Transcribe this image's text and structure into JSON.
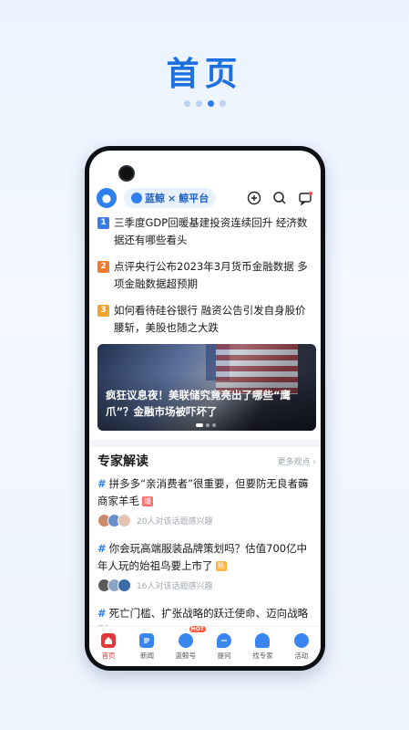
{
  "hero": {
    "title": "首页",
    "pager_count": 4,
    "pager_active": 2
  },
  "app": {
    "platform_name": "蓝鲸",
    "platform_sep": "×",
    "platform_suffix": "鲸平台",
    "icons": [
      "plus-circle-icon",
      "search-icon",
      "message-icon"
    ]
  },
  "news": [
    {
      "rank": "1",
      "text": "三季度GDP回暖基建投资连续回升 经济数据还有哪些看头"
    },
    {
      "rank": "2",
      "text": "点评央行公布2023年3月货币金融数据 多项金融数据超预期"
    },
    {
      "rank": "3",
      "text": "如何看待硅谷银行 融资公告引发自身股价腰斩，美股也随之大跌"
    }
  ],
  "banner": {
    "caption": "疯狂议息夜！美联储究竟亮出了哪些“鹰爪”？金融市场被吓坏了"
  },
  "experts": {
    "title": "专家解读",
    "more": "更多观点 ›",
    "topics": [
      {
        "text": "拼多多“亲消费者”很重要，但要防无良者薅商家羊毛",
        "tag": "爆",
        "meta": "20人对该话题感兴趣",
        "avatar_colors": [
          "#c98a6a",
          "#6a8fc9",
          "#e5c3b3"
        ]
      },
      {
        "text": "你会玩高端服装品牌策划吗？估值700亿中年人玩的始祖鸟要上市了",
        "tag": "热",
        "meta": "16人对该话题感兴趣",
        "avatar_colors": [
          "#5a5a5a",
          "#8aa4c8",
          "#3d6aa8"
        ]
      },
      {
        "text": "死亡门槛、扩张战略的跃迁使命、迈向战略型",
        "tag": "",
        "meta": "",
        "avatar_colors": []
      }
    ]
  },
  "tabs": [
    {
      "label": "首页",
      "icon": "home-icon",
      "color": "#e03a3a",
      "active": true
    },
    {
      "label": "新闻",
      "icon": "news-icon",
      "color": "#3a86f0",
      "active": false
    },
    {
      "label": "蓝鲸号",
      "icon": "whale-icon",
      "color": "#3a86f0",
      "active": false,
      "badge": "HOT"
    },
    {
      "label": "提问",
      "icon": "question-icon",
      "color": "#3a86f0",
      "active": false
    },
    {
      "label": "找专家",
      "icon": "expert-icon",
      "color": "#3a86f0",
      "active": false
    },
    {
      "label": "活动",
      "icon": "activity-icon",
      "color": "#3a86f0",
      "active": false
    }
  ]
}
